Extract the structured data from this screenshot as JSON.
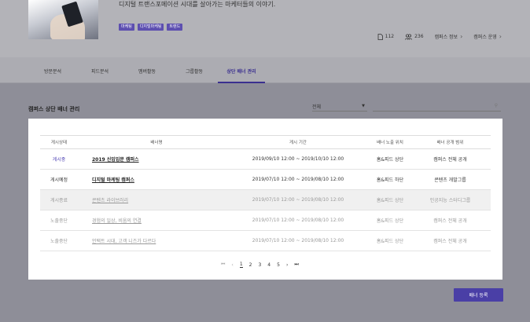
{
  "hero": {
    "description": "디지털 트랜스포메이션 시대를 살아가는 마케터들의 이야기.",
    "tags": [
      "마케팅",
      "디지털마케팅",
      "트렌드"
    ],
    "posts": "112",
    "members": "236",
    "info_link": "캠퍼스 정보",
    "manage_link": "캠퍼스 운영"
  },
  "tabs": [
    "방문분석",
    "피드분석",
    "멤버활동",
    "그룹활동",
    "상단 배너 관리"
  ],
  "section": {
    "title": "캠퍼스 상단 배너 관리",
    "filter_value": "전체",
    "search_placeholder": ""
  },
  "table": {
    "headers": {
      "status": "게시상태",
      "name": "배너명",
      "period": "게시 기간",
      "position": "배너 노출 위치",
      "scope": "배너 공개 범위"
    },
    "rows": [
      {
        "status": "게시중",
        "name": "2019 신입입문 캠퍼스",
        "period": "2019/09/10 12:00 ~ 2019/10/10 12:00",
        "position": "홈&피드 상단",
        "scope": "캠퍼스 전체 공개"
      },
      {
        "status": "게시예정",
        "name": "디지털 마케팅 캠퍼스",
        "period": "2019/07/10 12:00 ~ 2019/08/10 12:00",
        "position": "홈&피드 하단",
        "scope": "콘텐츠 개발그룹"
      },
      {
        "status": "게시종료",
        "name": "콘텐츠 라이브러리",
        "period": "2019/07/10 12:00 ~ 2019/08/10 12:00",
        "position": "홈&피드 상단",
        "scope": "인공지능 스터디그룹"
      },
      {
        "status": "노출중단",
        "name": "경험의 일상, 비움의 연결",
        "period": "2019/07/10 12:00 ~ 2019/08/10 12:00",
        "position": "홈&피드 상단",
        "scope": "캠퍼스 전체 공개"
      },
      {
        "status": "노출중단",
        "name": "언택트 시대, 고객 니즈가 다르다",
        "period": "2019/07/10 12:00 ~ 2019/08/10 12:00",
        "position": "홈&피드 상단",
        "scope": "캠퍼스 전체 공개"
      }
    ]
  },
  "pager": {
    "first": "⏮",
    "prev": "‹",
    "pages": [
      "1",
      "2",
      "3",
      "4",
      "5"
    ],
    "next": "›",
    "last": "⏭",
    "current": "1"
  },
  "register_button": "배너 등록"
}
